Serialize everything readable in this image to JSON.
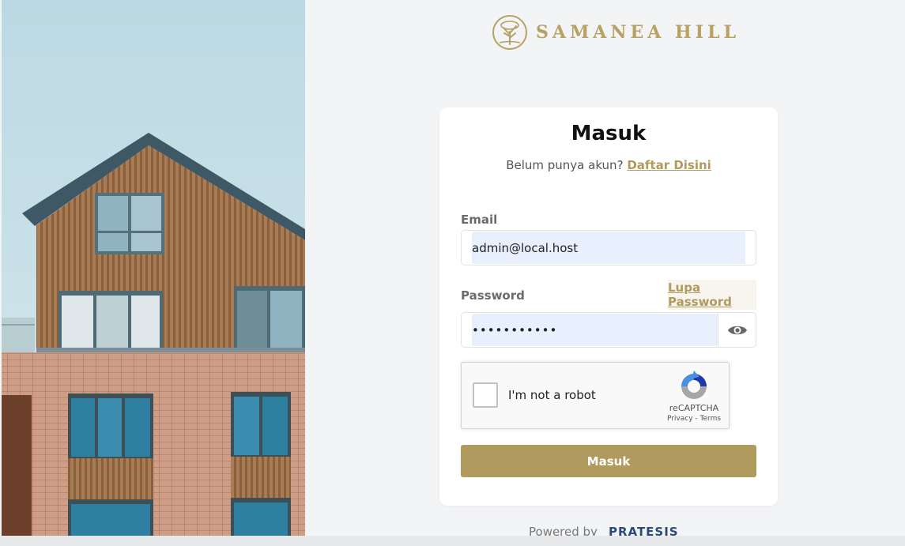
{
  "brand": {
    "name": "SAMANEA HILL",
    "color": "#b7a163",
    "logo_icon": "tree-icon"
  },
  "login": {
    "title": "Masuk",
    "subtitle_text": "Belum punya akun?",
    "register_link": "Daftar Disini",
    "email_label": "Email",
    "email_value": "admin@local.host",
    "password_label": "Password",
    "forgot_link": "Lupa Password",
    "password_value": "•••••••••••",
    "show_password_icon": "eye-icon",
    "submit_label": "Masuk",
    "accent_color": "#b09a5e"
  },
  "captcha": {
    "label": "I'm not a robot",
    "brand": "reCAPTCHA",
    "privacy": "Privacy",
    "separator": " - ",
    "terms": "Terms",
    "checked": false
  },
  "footer": {
    "powered_text": "Powered by",
    "powered_brand": "PRATESIS"
  }
}
